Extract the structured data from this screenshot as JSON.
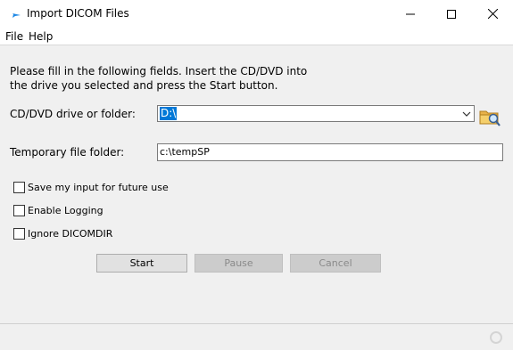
{
  "window": {
    "title": "Import DICOM Files"
  },
  "menu": {
    "items": [
      "File",
      "Help"
    ]
  },
  "instructions": {
    "line1": "Please fill in the following fields. Insert the CD/DVD into",
    "line2": "the drive you selected and press the Start button."
  },
  "fields": {
    "drive_label": "CD/DVD drive or folder:",
    "drive_value": "D:\\",
    "temp_label": "Temporary file folder:",
    "temp_value": "c:\\tempSP"
  },
  "options": [
    {
      "label": "Save my input for future use",
      "checked": false
    },
    {
      "label": "Enable Logging",
      "checked": false
    },
    {
      "label": "Ignore DICOMDIR",
      "checked": false
    }
  ],
  "buttons": {
    "start": "Start",
    "pause": "Pause",
    "cancel": "Cancel"
  },
  "icons": {
    "app": "app-bird-icon",
    "browse": "folder-search-icon",
    "status": "busy-spinner-icon"
  }
}
